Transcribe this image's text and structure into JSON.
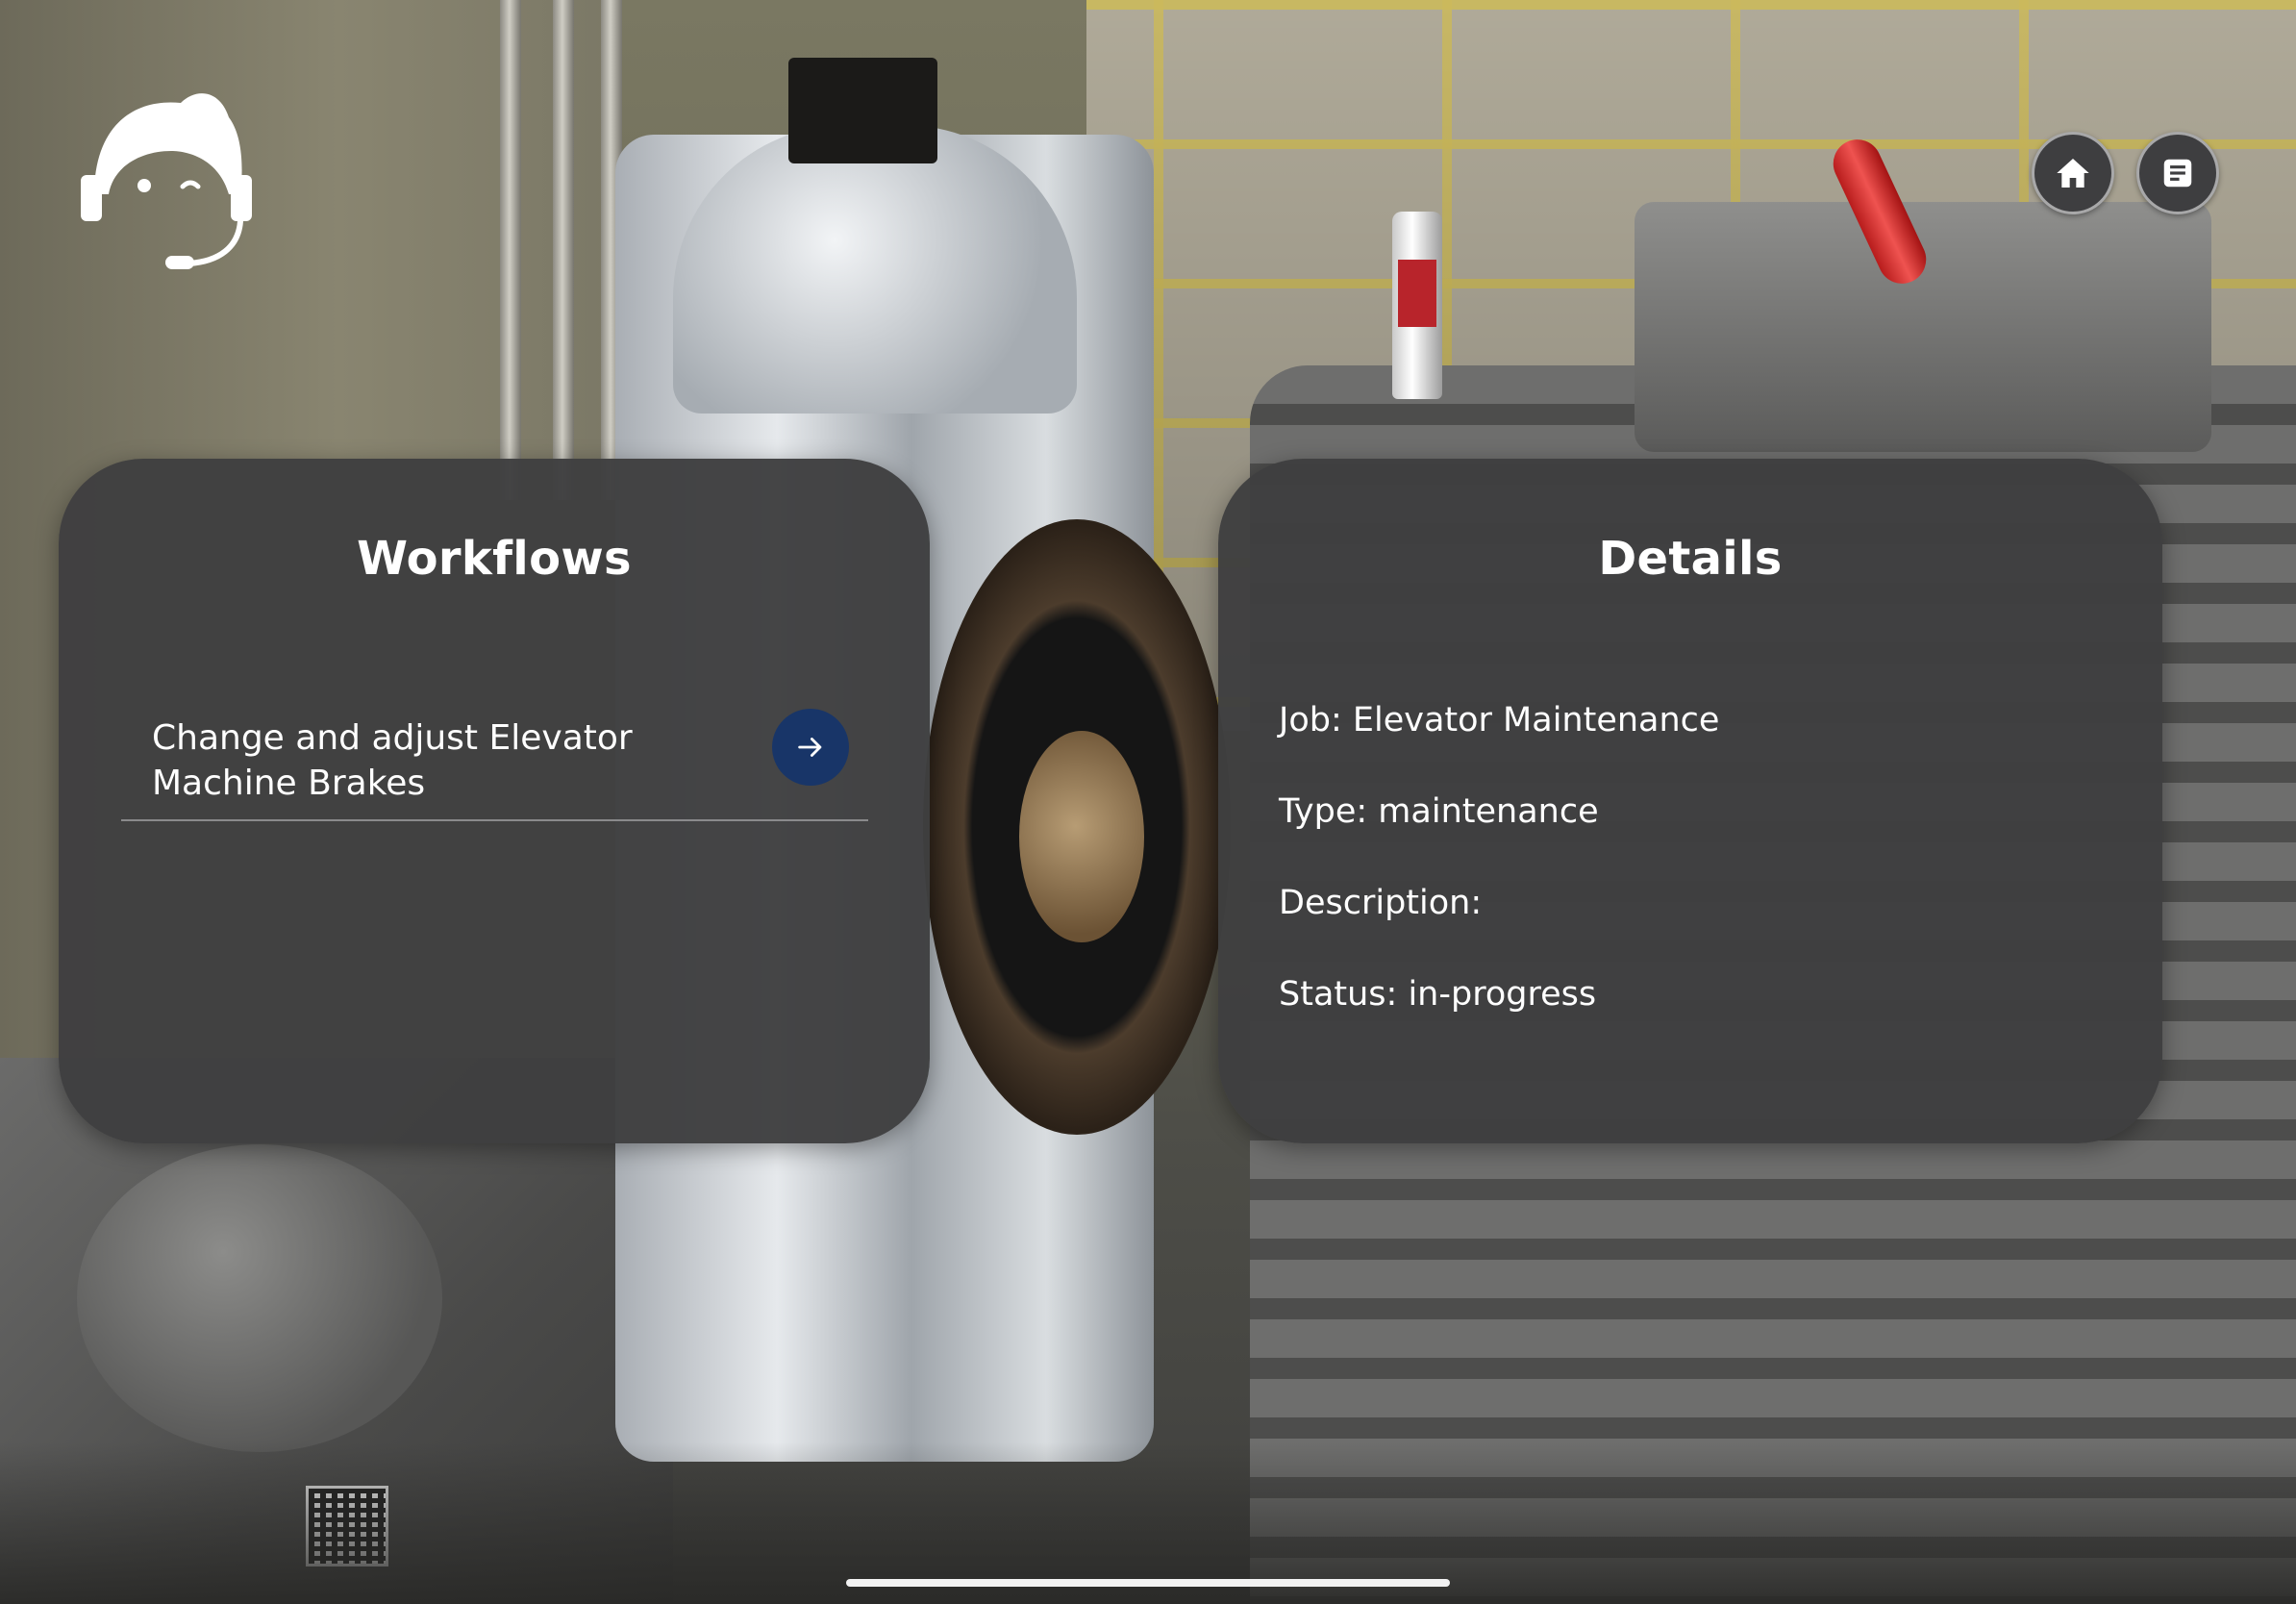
{
  "header": {
    "assistant_icon": "support-agent-headset-icon",
    "home_icon": "home-icon",
    "document_icon": "document-list-icon"
  },
  "workflows_panel": {
    "title": "Workflows",
    "items": [
      {
        "label": "Change and adjust Elevator Machine Brakes",
        "action_icon": "arrow-right-icon"
      }
    ]
  },
  "details_panel": {
    "title": "Details",
    "job": "Job: Elevator Maintenance",
    "type": "Type: maintenance",
    "description": "Description:",
    "status": "Status: in-progress"
  },
  "colors": {
    "panel_background": "#3f3f40",
    "action_button": "#183568",
    "text": "#ffffff"
  }
}
